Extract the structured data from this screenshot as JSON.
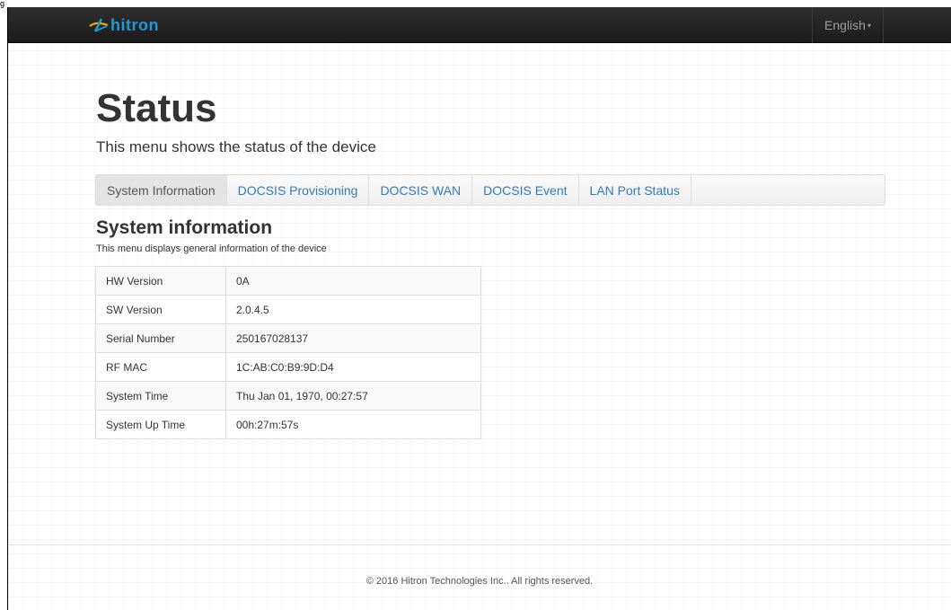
{
  "corner_glyph": "g",
  "navbar": {
    "logo_text": "hitron",
    "language_label": "English",
    "language_caret": "▾"
  },
  "header": {
    "title": "Status",
    "subtitle": "This menu shows the status of the device"
  },
  "tabs": [
    {
      "label": "System Information",
      "active": true
    },
    {
      "label": "DOCSIS Provisioning",
      "active": false
    },
    {
      "label": "DOCSIS WAN",
      "active": false
    },
    {
      "label": "DOCSIS Event",
      "active": false
    },
    {
      "label": "LAN Port Status",
      "active": false
    }
  ],
  "section": {
    "title": "System information",
    "subtitle": "This menu displays general information of the device"
  },
  "system_info": [
    {
      "key": "HW Version",
      "value": "0A"
    },
    {
      "key": "SW Version",
      "value": "2.0.4.5"
    },
    {
      "key": "Serial Number",
      "value": "250167028137"
    },
    {
      "key": "RF MAC",
      "value": "1C:AB:C0:B9:9D:D4"
    },
    {
      "key": "System Time",
      "value": "Thu Jan 01, 1970, 00:27:57"
    },
    {
      "key": "System Up Time",
      "value": "00h:27m:57s"
    }
  ],
  "footer": {
    "copyright": "© 2016 Hitron Technologies Inc.. All rights reserved."
  },
  "colors": {
    "navbar_bg": "#222222",
    "brand": "#1e9bd7",
    "link": "#337ab7"
  }
}
